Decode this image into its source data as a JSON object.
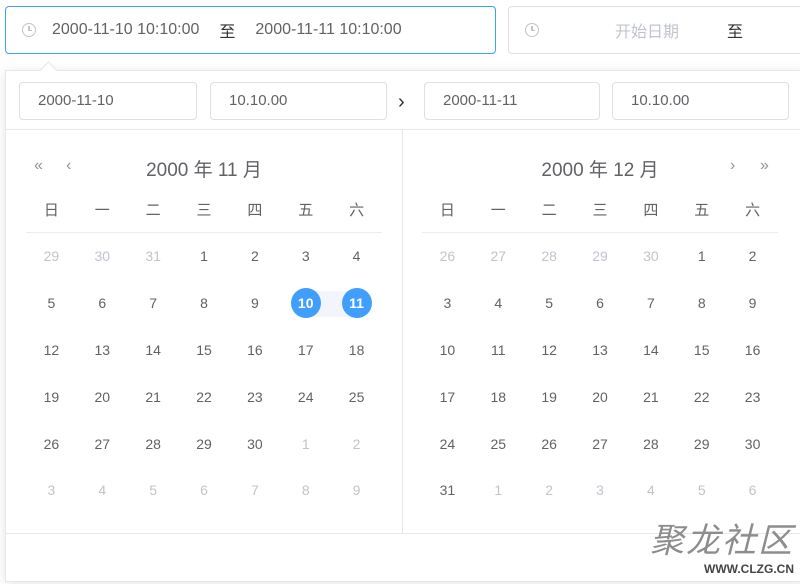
{
  "range1": {
    "start": "2000-11-10 10:10:00",
    "sep": "至",
    "end": "2000-11-11 10:10:00"
  },
  "range2": {
    "start_placeholder": "开始日期",
    "sep": "至"
  },
  "panel": {
    "start_date": "2000-11-10",
    "start_time": "10.10.00",
    "end_date": "2000-11-11",
    "end_time": "10.10.00",
    "weekdays": [
      "日",
      "一",
      "二",
      "三",
      "四",
      "五",
      "六"
    ],
    "left": {
      "title": "2000 年 11 月",
      "days": [
        {
          "d": "29",
          "m": 1
        },
        {
          "d": "30",
          "m": 1
        },
        {
          "d": "31",
          "m": 1
        },
        {
          "d": "1"
        },
        {
          "d": "2"
        },
        {
          "d": "3"
        },
        {
          "d": "4"
        },
        {
          "d": "5"
        },
        {
          "d": "6"
        },
        {
          "d": "7"
        },
        {
          "d": "8"
        },
        {
          "d": "9"
        },
        {
          "d": "10",
          "s": "start"
        },
        {
          "d": "11",
          "s": "end"
        },
        {
          "d": "12"
        },
        {
          "d": "13"
        },
        {
          "d": "14"
        },
        {
          "d": "15"
        },
        {
          "d": "16"
        },
        {
          "d": "17"
        },
        {
          "d": "18"
        },
        {
          "d": "19"
        },
        {
          "d": "20"
        },
        {
          "d": "21"
        },
        {
          "d": "22"
        },
        {
          "d": "23"
        },
        {
          "d": "24"
        },
        {
          "d": "25"
        },
        {
          "d": "26"
        },
        {
          "d": "27"
        },
        {
          "d": "28"
        },
        {
          "d": "29"
        },
        {
          "d": "30"
        },
        {
          "d": "1",
          "m": 1
        },
        {
          "d": "2",
          "m": 1
        },
        {
          "d": "3",
          "m": 1
        },
        {
          "d": "4",
          "m": 1
        },
        {
          "d": "5",
          "m": 1
        },
        {
          "d": "6",
          "m": 1
        },
        {
          "d": "7",
          "m": 1
        },
        {
          "d": "8",
          "m": 1
        },
        {
          "d": "9",
          "m": 1
        }
      ]
    },
    "right": {
      "title": "2000 年 12 月",
      "days": [
        {
          "d": "26",
          "m": 1
        },
        {
          "d": "27",
          "m": 1
        },
        {
          "d": "28",
          "m": 1
        },
        {
          "d": "29",
          "m": 1
        },
        {
          "d": "30",
          "m": 1
        },
        {
          "d": "1"
        },
        {
          "d": "2"
        },
        {
          "d": "3"
        },
        {
          "d": "4"
        },
        {
          "d": "5"
        },
        {
          "d": "6"
        },
        {
          "d": "7"
        },
        {
          "d": "8"
        },
        {
          "d": "9"
        },
        {
          "d": "10"
        },
        {
          "d": "11"
        },
        {
          "d": "12"
        },
        {
          "d": "13"
        },
        {
          "d": "14"
        },
        {
          "d": "15"
        },
        {
          "d": "16"
        },
        {
          "d": "17"
        },
        {
          "d": "18"
        },
        {
          "d": "19"
        },
        {
          "d": "20"
        },
        {
          "d": "21"
        },
        {
          "d": "22"
        },
        {
          "d": "23"
        },
        {
          "d": "24"
        },
        {
          "d": "25"
        },
        {
          "d": "26"
        },
        {
          "d": "27"
        },
        {
          "d": "28"
        },
        {
          "d": "29"
        },
        {
          "d": "30"
        },
        {
          "d": "31"
        },
        {
          "d": "1",
          "m": 1
        },
        {
          "d": "2",
          "m": 1
        },
        {
          "d": "3",
          "m": 1
        },
        {
          "d": "4",
          "m": 1
        },
        {
          "d": "5",
          "m": 1
        },
        {
          "d": "6",
          "m": 1
        }
      ]
    }
  },
  "watermark": {
    "cn": "聚龙社区",
    "en": "WWW.CLZG.CN"
  },
  "colors": {
    "accent": "#409eff",
    "range_bg": "#f2f6fc",
    "muted": "#c0c4cc"
  }
}
